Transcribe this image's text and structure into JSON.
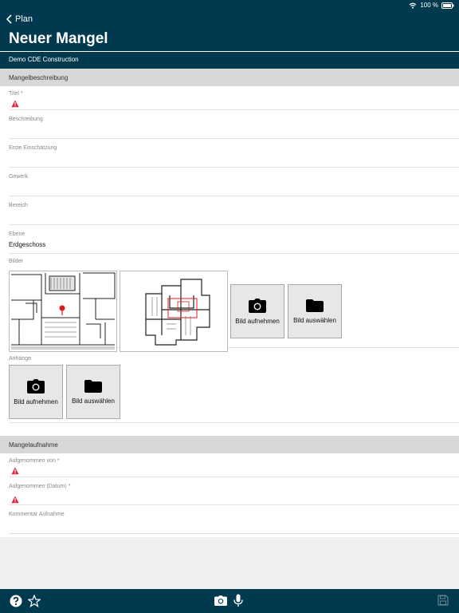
{
  "status": {
    "battery": "100 %"
  },
  "nav": {
    "back_label": "Plan"
  },
  "header": {
    "title": "Neuer Mangel",
    "project": "Demo CDE Construction"
  },
  "sections": {
    "description": "Mangelbeschreibung",
    "capture": "Mangelaufnahme"
  },
  "fields": {
    "title": {
      "label": "Titel *",
      "value": ""
    },
    "description": {
      "label": "Beschreibung",
      "value": ""
    },
    "assessment": {
      "label": "Erste Einschätzung",
      "value": ""
    },
    "trade": {
      "label": "Gewerk",
      "value": ""
    },
    "area": {
      "label": "Bereich",
      "value": ""
    },
    "level": {
      "label": "Ebene",
      "value": "Erdgeschoss"
    },
    "recorded_by": {
      "label": "Aufgenommen von *",
      "value": ""
    },
    "recorded_date": {
      "label": "Aufgenommen (Datum) *",
      "value": ""
    },
    "comment": {
      "label": "Kommentar Aufnahme",
      "value": ""
    }
  },
  "images": {
    "label": "Bilder",
    "take_photo": "Bild aufnehmen",
    "choose_image": "Bild auswählen"
  },
  "attachments": {
    "label": "Anhänge",
    "take_photo": "Bild aufnehmen",
    "choose_image": "Bild auswählen"
  },
  "icons": {
    "warning": "warning-icon",
    "camera": "camera-icon",
    "folder": "folder-icon",
    "help": "help-icon",
    "star": "star-icon",
    "microphone": "microphone-icon",
    "save": "save-icon",
    "wifi": "wifi-icon",
    "battery": "battery-icon",
    "back": "chevron-left-icon"
  },
  "colors": {
    "header": "#013a4f",
    "warning": "#e0243a",
    "pin": "#e0191f"
  }
}
